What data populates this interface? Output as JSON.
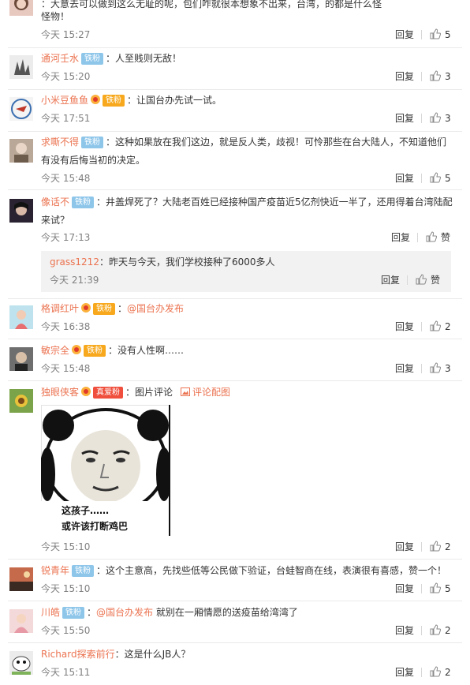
{
  "comments": [
    {
      "user": "",
      "text_line1": "：大意去可以做到这么无耻的呢，包们咋就很本想象不出来，台湾，的都是什么怪",
      "text_line2": "怪物！",
      "time": "今天 15:27",
      "reply": "回复",
      "likes": "5"
    },
    {
      "user": "通河壬水",
      "badge": "铁粉",
      "text": "：人至贱则无敌！",
      "time": "今天 15:20",
      "reply": "回复",
      "likes": "3"
    },
    {
      "user": "小米豆鱼鱼",
      "badge": "铁粉",
      "text": "：让国台办先试一试。",
      "time": "今天 17:51",
      "reply": "回复",
      "likes": "3"
    },
    {
      "user": "求嘶不得",
      "badge": "铁粉",
      "text_line1": "：这种如果放在我们这边，就是反人类，歧视！可怜那些在台大陆人，不知道他们",
      "text_line2": "有没有后悔当初的决定。",
      "time": "今天 15:48",
      "reply": "回复",
      "likes": "5"
    },
    {
      "user": "像话不",
      "badge": "铁粉",
      "text_line1": "：井盖焊死了？大陆老百姓已经接种国产疫苗近5亿剂快近一半了，还用得着台湾陆配",
      "text_line2": "来试？",
      "time": "今天 17:13",
      "reply": "回复",
      "likes": "赞",
      "subreply": {
        "user": "grass1212",
        "text": "：昨天与今天，我们学校接种了6000多人",
        "time": "今天 21:39",
        "reply": "回复",
        "likes": "赞"
      }
    },
    {
      "user": "格调红叶",
      "badge": "铁粉",
      "mention": "@国台办发布",
      "text": "：",
      "time": "今天 16:38",
      "reply": "回复",
      "likes": "2"
    },
    {
      "user": "敏宗全",
      "badge": "铁粉",
      "text": "：没有人性啊……",
      "time": "今天 15:48",
      "reply": "回复",
      "likes": "3"
    },
    {
      "user": "独眼侠客",
      "badge": "真爱粉",
      "text": "：图片评论",
      "pic_link": "评论配图",
      "meme_line1": "这孩子……",
      "meme_line2": "或许该打断鸡巴",
      "time": "今天 15:10",
      "reply": "回复",
      "likes": "2"
    },
    {
      "user": "锐青年",
      "badge": "铁粉",
      "text": "：这个主意高，先找些低等公民做下验证，台蛙智商在线，表演很有喜感，赞一个！",
      "time": "今天 15:10",
      "reply": "回复",
      "likes": "5"
    },
    {
      "user": "川皓",
      "badge": "铁粉",
      "text_pre": "：",
      "mention": "@国台办发布",
      "text": " 就别在一厢情愿的送疫苗给湾湾了",
      "time": "今天 15:50",
      "reply": "回复",
      "likes": "2"
    },
    {
      "user": "Richard探索前行",
      "text": "：这是什么JB人？",
      "time": "今天 15:11",
      "reply": "回复",
      "likes": "2"
    }
  ],
  "colors": {
    "username": "#eb7350",
    "badge": "#8ec6ea",
    "badge_gold": "#f7a81c",
    "time": "#808080",
    "separator": "#eaeaea"
  },
  "icons": [
    "thumbs-up-icon",
    "crown-icon",
    "picture-icon",
    "avatar"
  ]
}
